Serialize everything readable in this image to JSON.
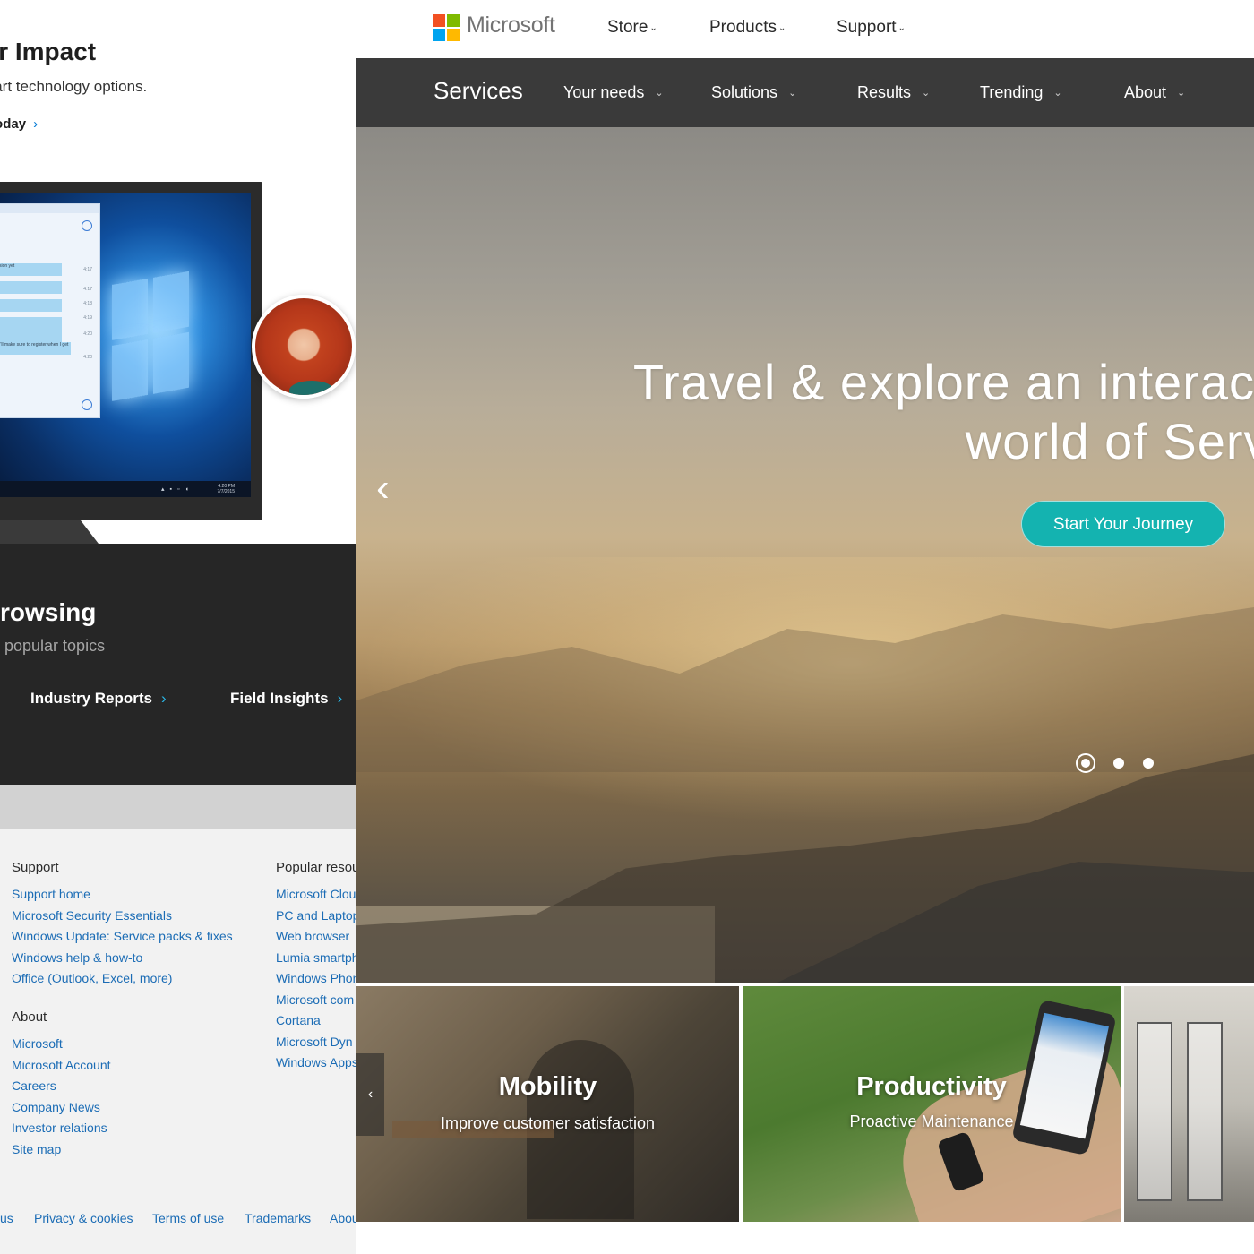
{
  "left_page": {
    "hero_title": "our Impact",
    "hero_subtitle": "start technology options.",
    "hero_link": "Today",
    "browse_title": "rowsing",
    "browse_subtitle": "r popular topics",
    "topic_links": [
      "Industry Reports",
      "Field Insights"
    ],
    "monitor_clock": "4:20 PM\n7/7/2015",
    "chat_lines": [
      "sion yet",
      "I'll make sure to register when I get"
    ],
    "chat_times": [
      "4:17",
      "4:17",
      "4:18",
      "4:19",
      "4:20",
      "4:20"
    ],
    "footer": {
      "support": {
        "heading": "Support",
        "links": [
          "Support home",
          "Microsoft Security Essentials",
          "Windows Update: Service packs & fixes",
          "Windows help & how-to",
          "Office (Outlook, Excel, more)"
        ]
      },
      "about": {
        "heading": "About",
        "links": [
          "Microsoft",
          "Microsoft Account",
          "Careers",
          "Company News",
          "Investor relations",
          "Site map"
        ]
      },
      "popular": {
        "heading": "Popular resou",
        "links": [
          "Microsoft Clou",
          "PC and Laptop",
          "Web browser",
          "Lumia smartph",
          "Windows Phon",
          "Microsoft com",
          "Cortana",
          "Microsoft Dyn",
          "Windows Apps"
        ]
      },
      "bottom_links": [
        "us",
        "Privacy & cookies",
        "Terms of use",
        "Trademarks",
        "Abou"
      ]
    }
  },
  "right_page": {
    "brand": "Microsoft",
    "top_nav": [
      "Store",
      "Products",
      "Support"
    ],
    "services_title": "Services",
    "services_nav": [
      "Your needs",
      "Solutions",
      "Results",
      "Trending",
      "About"
    ],
    "hero": {
      "headline_line1": "Travel & explore an interactiv",
      "headline_line2": "world of Servic",
      "cta": "Start Your Journey",
      "slide_count": 3,
      "active_slide": 1
    },
    "tiles": [
      {
        "title": "Mobility",
        "subtitle": "Improve customer satisfaction"
      },
      {
        "title": "Productivity",
        "subtitle": "Proactive Maintenance"
      }
    ]
  },
  "colors": {
    "accent_teal": "#14b3b0",
    "link_blue": "#1b6cb5",
    "dark_band": "#262626",
    "services_bar": "#3a3a3a"
  }
}
